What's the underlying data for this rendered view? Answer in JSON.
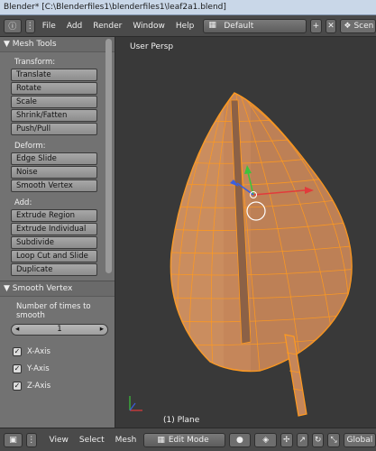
{
  "window": {
    "title": "Blender* [C:\\Blenderfiles1\\blenderfiles1\\leaf2a1.blend]"
  },
  "topbar": {
    "menus": [
      "File",
      "Add",
      "Render",
      "Window",
      "Help"
    ],
    "screen_layout": "Default",
    "scene": "Scen"
  },
  "toolshelf": {
    "header": "Mesh Tools",
    "transform_label": "Transform:",
    "transform": [
      "Translate",
      "Rotate",
      "Scale",
      "Shrink/Fatten",
      "Push/Pull"
    ],
    "deform_label": "Deform:",
    "deform": [
      "Edge Slide",
      "Noise",
      "Smooth Vertex"
    ],
    "add_label": "Add:",
    "add": [
      "Extrude Region",
      "Extrude Individual",
      "Subdivide",
      "Loop Cut and Slide",
      "Duplicate"
    ]
  },
  "operator": {
    "header": "Smooth Vertex",
    "repeat_label": "Number of times to smooth",
    "repeat_value": "1",
    "axes": [
      {
        "label": "X-Axis",
        "checked": true
      },
      {
        "label": "Y-Axis",
        "checked": true
      },
      {
        "label": "Z-Axis",
        "checked": true
      }
    ]
  },
  "viewport": {
    "view_label": "User Persp",
    "object_label": "(1) Plane"
  },
  "footer": {
    "menus": [
      "View",
      "Select",
      "Mesh"
    ],
    "mode": "Edit Mode",
    "orientation": "Global"
  },
  "colors": {
    "mesh_edge": "#ff9a1f",
    "mesh_face": "#c5865a",
    "background": "#393939"
  }
}
